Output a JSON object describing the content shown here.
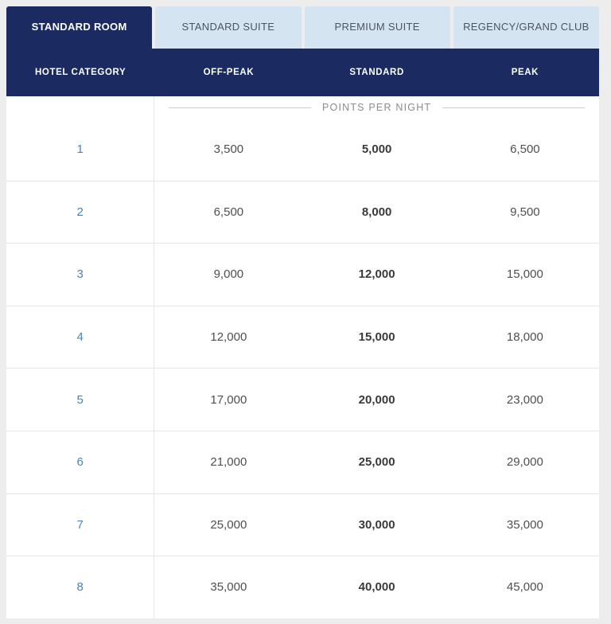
{
  "colors": {
    "navy": "#1b2b61",
    "tab_inactive_bg": "#d5e4f1",
    "tab_inactive_text": "#4e555e",
    "link_blue": "#4d82b8",
    "value_text": "#4f4f4f",
    "value_bold_text": "#3a3a3a",
    "section_label_text": "#8c8c8c",
    "divider_line": "#cccccc",
    "row_border": "#e6e6e6",
    "page_background": "#ededed"
  },
  "tabs": [
    {
      "label": "STANDARD ROOM",
      "active": true
    },
    {
      "label": "STANDARD SUITE",
      "active": false
    },
    {
      "label": "PREMIUM SUITE",
      "active": false
    },
    {
      "label": "REGENCY/GRAND CLUB",
      "active": false
    }
  ],
  "table": {
    "column_headers": [
      "HOTEL CATEGORY",
      "OFF-PEAK",
      "STANDARD",
      "PEAK"
    ],
    "section_label": "POINTS PER NIGHT",
    "rows": [
      {
        "category": "1",
        "off_peak": "3,500",
        "standard": "5,000",
        "peak": "6,500"
      },
      {
        "category": "2",
        "off_peak": "6,500",
        "standard": "8,000",
        "peak": "9,500"
      },
      {
        "category": "3",
        "off_peak": "9,000",
        "standard": "12,000",
        "peak": "15,000"
      },
      {
        "category": "4",
        "off_peak": "12,000",
        "standard": "15,000",
        "peak": "18,000"
      },
      {
        "category": "5",
        "off_peak": "17,000",
        "standard": "20,000",
        "peak": "23,000"
      },
      {
        "category": "6",
        "off_peak": "21,000",
        "standard": "25,000",
        "peak": "29,000"
      },
      {
        "category": "7",
        "off_peak": "25,000",
        "standard": "30,000",
        "peak": "35,000"
      },
      {
        "category": "8",
        "off_peak": "35,000",
        "standard": "40,000",
        "peak": "45,000"
      }
    ]
  }
}
